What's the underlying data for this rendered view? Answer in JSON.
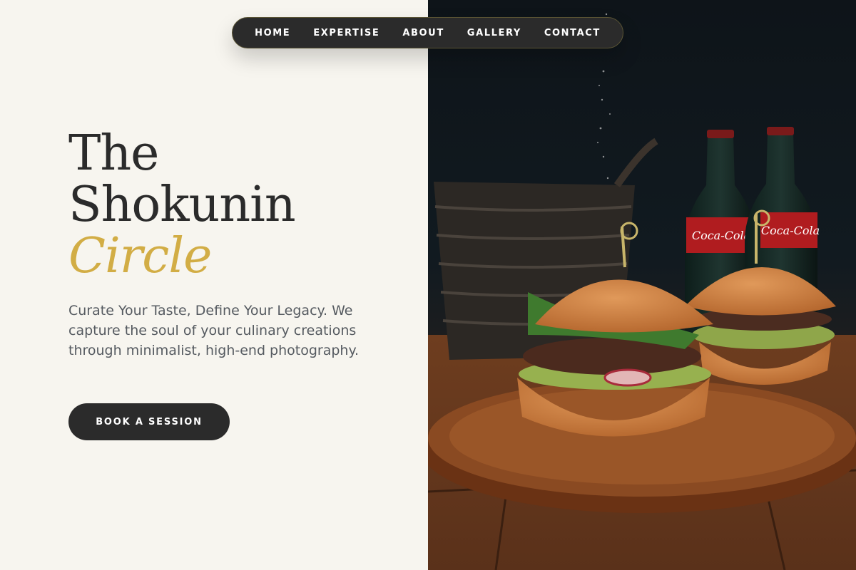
{
  "nav": {
    "items": [
      {
        "label": "HOME"
      },
      {
        "label": "EXPERTISE"
      },
      {
        "label": "ABOUT"
      },
      {
        "label": "GALLERY"
      },
      {
        "label": "CONTACT"
      }
    ]
  },
  "hero": {
    "title_line1": "The",
    "title_line2": "Shokunin",
    "title_accent": "Circle",
    "subtitle": "Curate Your Taste, Define Your Legacy. We capture the soul of your culinary creations through minimalist, high-end photography.",
    "cta_label": "BOOK A SESSION"
  },
  "image": {
    "bottle_label_1": "Coca-Cola",
    "bottle_label_2": "Coca-Cola"
  },
  "colors": {
    "background": "#f7f5ef",
    "dark": "#2b2b2b",
    "accent_gold": "#d2ad45",
    "body_text": "#555a60"
  }
}
